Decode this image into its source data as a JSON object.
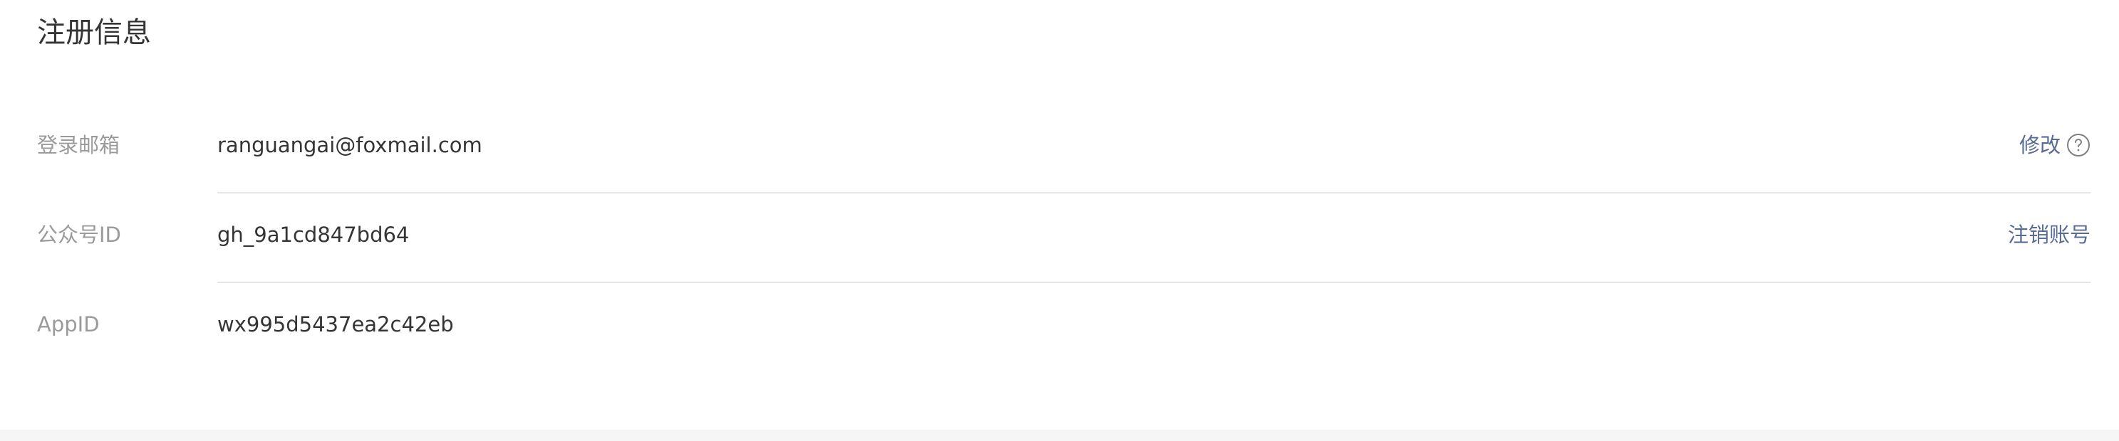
{
  "section": {
    "title": "注册信息"
  },
  "rows": [
    {
      "label": "登录邮箱",
      "value": "ranguangai@foxmail.com",
      "action": "修改",
      "action_icon": "help-circle-icon"
    },
    {
      "label": "公众号ID",
      "value": "gh_9a1cd847bd64",
      "action": "注销账号"
    },
    {
      "label": "AppID",
      "value": "wx995d5437ea2c42eb"
    }
  ],
  "colors": {
    "title": "#353535",
    "label": "#9a9a9a",
    "value": "#353535",
    "link": "#576b95",
    "divider": "#e6e6e6",
    "footer_band": "#f6f6f6"
  }
}
